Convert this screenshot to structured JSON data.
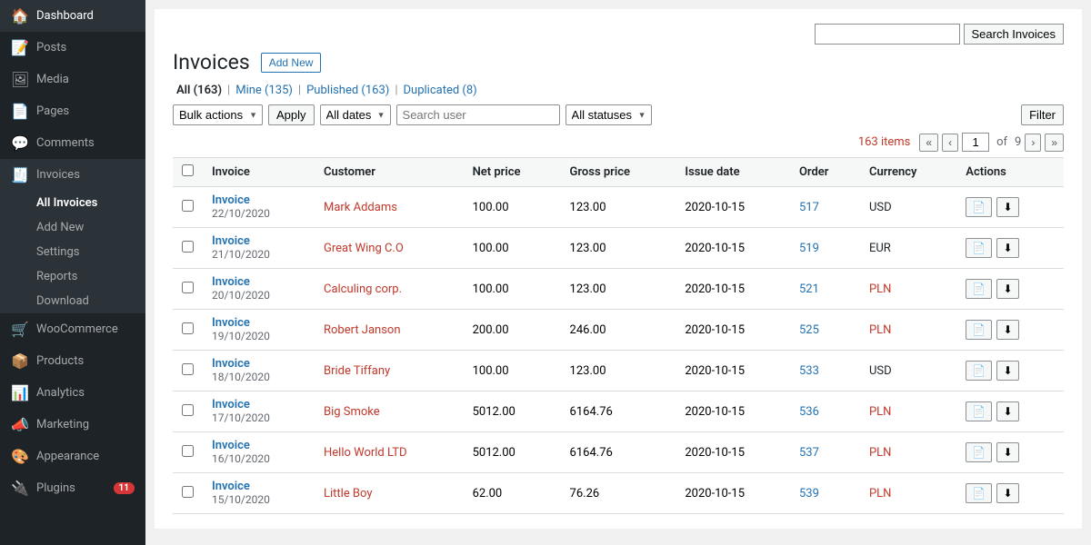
{
  "sidebar": {
    "items": [
      {
        "id": "dashboard",
        "label": "Dashboard",
        "icon": "🏠",
        "active": false
      },
      {
        "id": "posts",
        "label": "Posts",
        "icon": "📝",
        "active": false
      },
      {
        "id": "media",
        "label": "Media",
        "icon": "🖼",
        "active": false
      },
      {
        "id": "pages",
        "label": "Pages",
        "icon": "📄",
        "active": false
      },
      {
        "id": "comments",
        "label": "Comments",
        "icon": "💬",
        "active": false
      },
      {
        "id": "invoices",
        "label": "Invoices",
        "icon": "🧾",
        "active": true
      }
    ],
    "invoices_sub": [
      {
        "id": "all-invoices",
        "label": "All Invoices",
        "active": true
      },
      {
        "id": "add-new",
        "label": "Add New",
        "active": false
      },
      {
        "id": "settings",
        "label": "Settings",
        "active": false
      },
      {
        "id": "reports",
        "label": "Reports",
        "active": false
      },
      {
        "id": "download",
        "label": "Download",
        "active": false
      }
    ],
    "woocommerce": {
      "label": "WooCommerce",
      "icon": "🛒"
    },
    "products": {
      "label": "Products",
      "icon": "📦"
    },
    "analytics": {
      "label": "Analytics",
      "icon": "📊"
    },
    "marketing": {
      "label": "Marketing",
      "icon": "📣"
    },
    "appearance": {
      "label": "Appearance",
      "icon": "🎨"
    },
    "plugins": {
      "label": "Plugins",
      "icon": "🔌",
      "badge": "11"
    }
  },
  "page": {
    "title": "Invoices",
    "add_new_label": "Add New"
  },
  "search": {
    "input_placeholder": "",
    "button_label": "Search Invoices"
  },
  "filter_tabs": [
    {
      "id": "all",
      "label": "All",
      "count": 163,
      "current": true
    },
    {
      "id": "mine",
      "label": "Mine",
      "count": 135,
      "current": false
    },
    {
      "id": "published",
      "label": "Published",
      "count": 163,
      "current": false
    },
    {
      "id": "duplicated",
      "label": "Duplicated",
      "count": 8,
      "current": false
    }
  ],
  "toolbar": {
    "bulk_actions_label": "Bulk actions",
    "apply_label": "Apply",
    "all_dates_label": "All dates",
    "search_user_placeholder": "Search user",
    "all_statuses_label": "All statuses",
    "filter_label": "Filter"
  },
  "pagination": {
    "items_count": "163 items",
    "current_page": "1",
    "total_pages": "9"
  },
  "table": {
    "headers": [
      "",
      "Invoice",
      "Customer",
      "Net price",
      "Gross price",
      "Issue date",
      "Order",
      "Currency",
      "Actions"
    ],
    "rows": [
      {
        "id": 1,
        "invoice": "Invoice",
        "date": "22/10/2020",
        "customer": "Mark Addams",
        "net_price": "100.00",
        "gross_price": "123.00",
        "issue_date": "2020-10-15",
        "order": "517",
        "currency": "USD",
        "currency_type": "neutral"
      },
      {
        "id": 2,
        "invoice": "Invoice",
        "date": "21/10/2020",
        "customer": "Great Wing C.O",
        "net_price": "100.00",
        "gross_price": "123.00",
        "issue_date": "2020-10-15",
        "order": "519",
        "currency": "EUR",
        "currency_type": "neutral"
      },
      {
        "id": 3,
        "invoice": "Invoice",
        "date": "20/10/2020",
        "customer": "Calculing corp.",
        "net_price": "100.00",
        "gross_price": "123.00",
        "issue_date": "2020-10-15",
        "order": "521",
        "currency": "PLN",
        "currency_type": "pln"
      },
      {
        "id": 4,
        "invoice": "Invoice",
        "date": "19/10/2020",
        "customer": "Robert Janson",
        "net_price": "200.00",
        "gross_price": "246.00",
        "issue_date": "2020-10-15",
        "order": "525",
        "currency": "PLN",
        "currency_type": "pln"
      },
      {
        "id": 5,
        "invoice": "Invoice",
        "date": "18/10/2020",
        "customer": "Bride Tiffany",
        "net_price": "100.00",
        "gross_price": "123.00",
        "issue_date": "2020-10-15",
        "order": "533",
        "currency": "USD",
        "currency_type": "neutral"
      },
      {
        "id": 6,
        "invoice": "Invoice",
        "date": "17/10/2020",
        "customer": "Big Smoke",
        "net_price": "5012.00",
        "gross_price": "6164.76",
        "issue_date": "2020-10-15",
        "order": "536",
        "currency": "PLN",
        "currency_type": "pln"
      },
      {
        "id": 7,
        "invoice": "Invoice",
        "date": "16/10/2020",
        "customer": "Hello World LTD",
        "net_price": "5012.00",
        "gross_price": "6164.76",
        "issue_date": "2020-10-15",
        "order": "537",
        "currency": "PLN",
        "currency_type": "pln"
      },
      {
        "id": 8,
        "invoice": "Invoice",
        "date": "15/10/2020",
        "customer": "Little Boy",
        "net_price": "62.00",
        "gross_price": "76.26",
        "issue_date": "2020-10-15",
        "order": "539",
        "currency": "PLN",
        "currency_type": "pln"
      }
    ]
  }
}
